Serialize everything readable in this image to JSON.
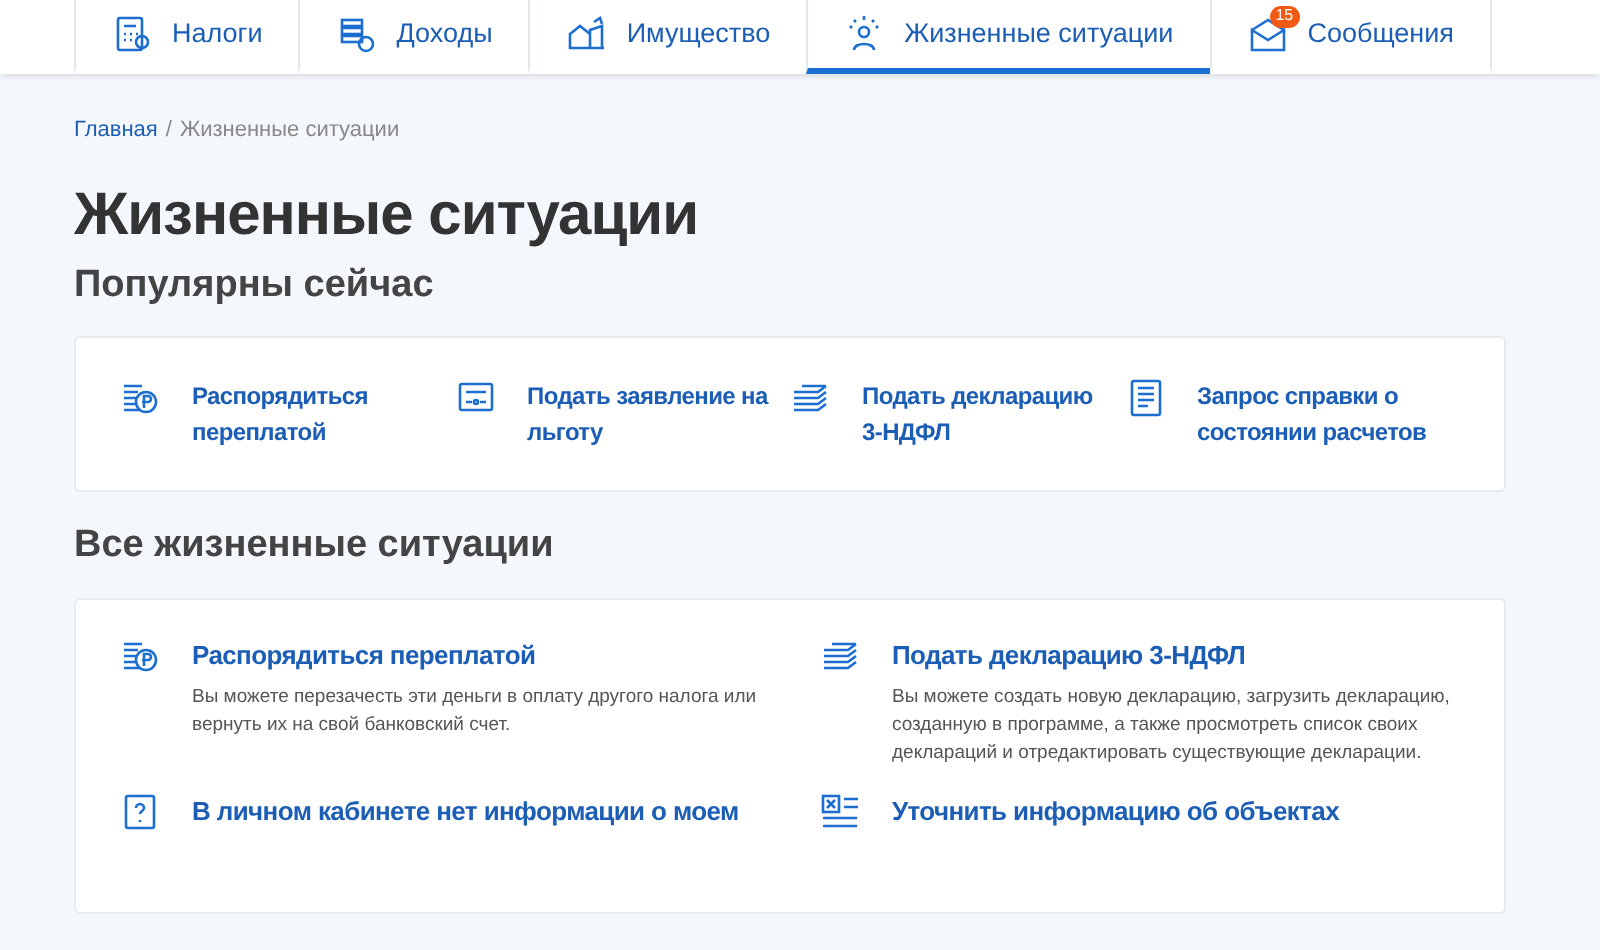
{
  "nav_tabs": [
    {
      "label": "Налоги",
      "selected": false
    },
    {
      "label": "Доходы",
      "selected": false
    },
    {
      "label": "Имущество",
      "selected": false
    },
    {
      "label": "Жизненные ситуации",
      "selected": true
    },
    {
      "label": "Сообщения",
      "selected": false,
      "badge": "15"
    }
  ],
  "breadcrumb": [
    "Главная",
    "/",
    "Жизненные ситуации"
  ],
  "page_title": "Жизненные ситуации",
  "popular": {
    "heading": "Популярны сейчас",
    "items": [
      {
        "title": "Распорядиться переплатой"
      },
      {
        "title": "Подать заявление на льготу"
      },
      {
        "title": "Подать декларацию 3-НДФЛ"
      },
      {
        "title": "Запрос справки о состоянии расчетов"
      }
    ]
  },
  "all": {
    "heading": "Все жизненные ситуации",
    "items": [
      {
        "title": "Распорядиться переплатой",
        "description": "Вы можете перезачесть эти деньги в оплату другого налога или вернуть их на свой банковский счет."
      },
      {
        "title": "Подать декларацию 3-НДФЛ",
        "description": "Вы можете создать новую декларацию, загрузить декларацию, созданную в программе, а также просмотреть список своих деклараций и отредактировать существующие декларации."
      },
      {
        "title": "В личном кабинете нет информации о моем"
      },
      {
        "title": "Уточнить информацию об объектах"
      }
    ]
  }
}
